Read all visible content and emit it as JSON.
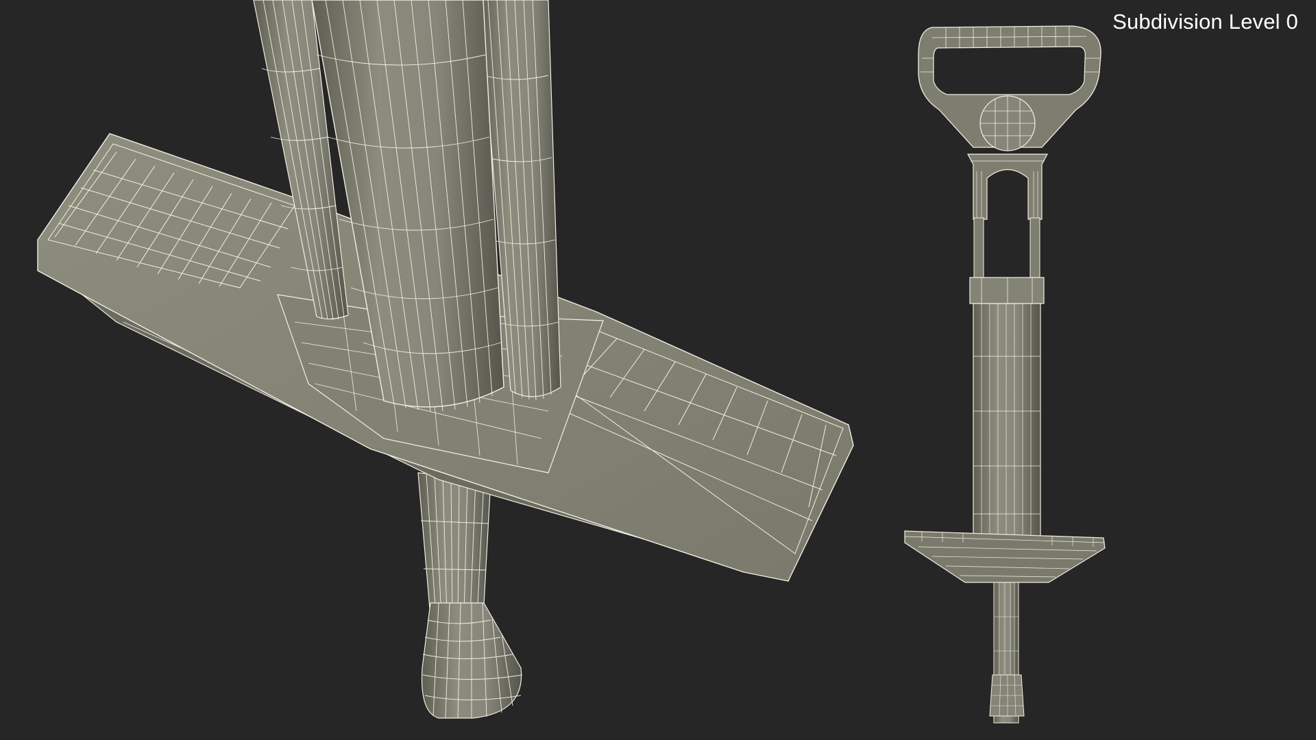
{
  "overlay": {
    "subdivision_label": "Subdivision Level 0"
  },
  "scene": {
    "subject": "pogo stick wireframe model",
    "views": [
      "close-up-footrest-view",
      "full-model-view"
    ]
  },
  "colors": {
    "background": "#262626",
    "mesh_fill": "#7a7a6c",
    "mesh_fill_light": "#8a8a7b",
    "mesh_fill_dark": "#5f5f54",
    "wire": "#f2f0e4"
  }
}
